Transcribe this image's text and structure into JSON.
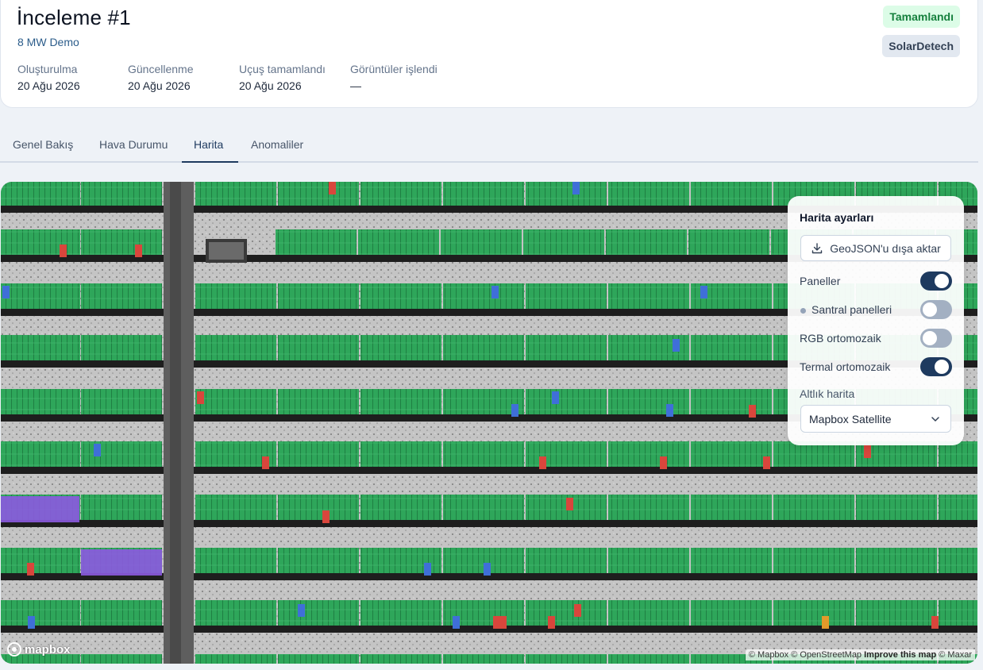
{
  "header": {
    "title": "İnceleme #1",
    "subtitle": "8 MW Demo",
    "status_badge": "Tamamlandı",
    "vendor_badge": "SolarDetech",
    "meta": [
      {
        "label": "Oluşturulma",
        "value": "20 Ağu 2026"
      },
      {
        "label": "Güncellenme",
        "value": "20 Ağu 2026"
      },
      {
        "label": "Uçuş tamamlandı",
        "value": "20 Ağu 2026"
      },
      {
        "label": "Görüntüler işlendi",
        "value": "—"
      }
    ]
  },
  "tabs": [
    {
      "label": "Genel Bakış",
      "active": false
    },
    {
      "label": "Hava Durumu",
      "active": false
    },
    {
      "label": "Harita",
      "active": true
    },
    {
      "label": "Anomaliler",
      "active": false
    }
  ],
  "map_settings": {
    "title": "Harita ayarları",
    "export_label": "GeoJSON'u dışa aktar",
    "layers": [
      {
        "label": "Paneller",
        "on": true
      },
      {
        "label": "Santral panelleri",
        "on": false
      },
      {
        "label": "RGB ortomozaik",
        "on": false
      },
      {
        "label": "Termal ortomozaik",
        "on": true
      }
    ],
    "basemap_label": "Altlık harita",
    "basemap_value": "Mapbox Satellite"
  },
  "map": {
    "logo_text": "mapbox",
    "attribution": {
      "mapbox": "© Mapbox",
      "osm": "© OpenStreetMap",
      "improve": "Improve this map",
      "maxar": "© Maxar"
    },
    "colors": {
      "panel": "#2ea65a",
      "anomaly_red": "#d9463c",
      "anomaly_blue": "#3f6fd8",
      "anomaly_orange": "#e39a2a",
      "anomaly_purple": "#8c5ae0",
      "ground": "#9a9a9a",
      "road": "#5e5e5e"
    }
  }
}
